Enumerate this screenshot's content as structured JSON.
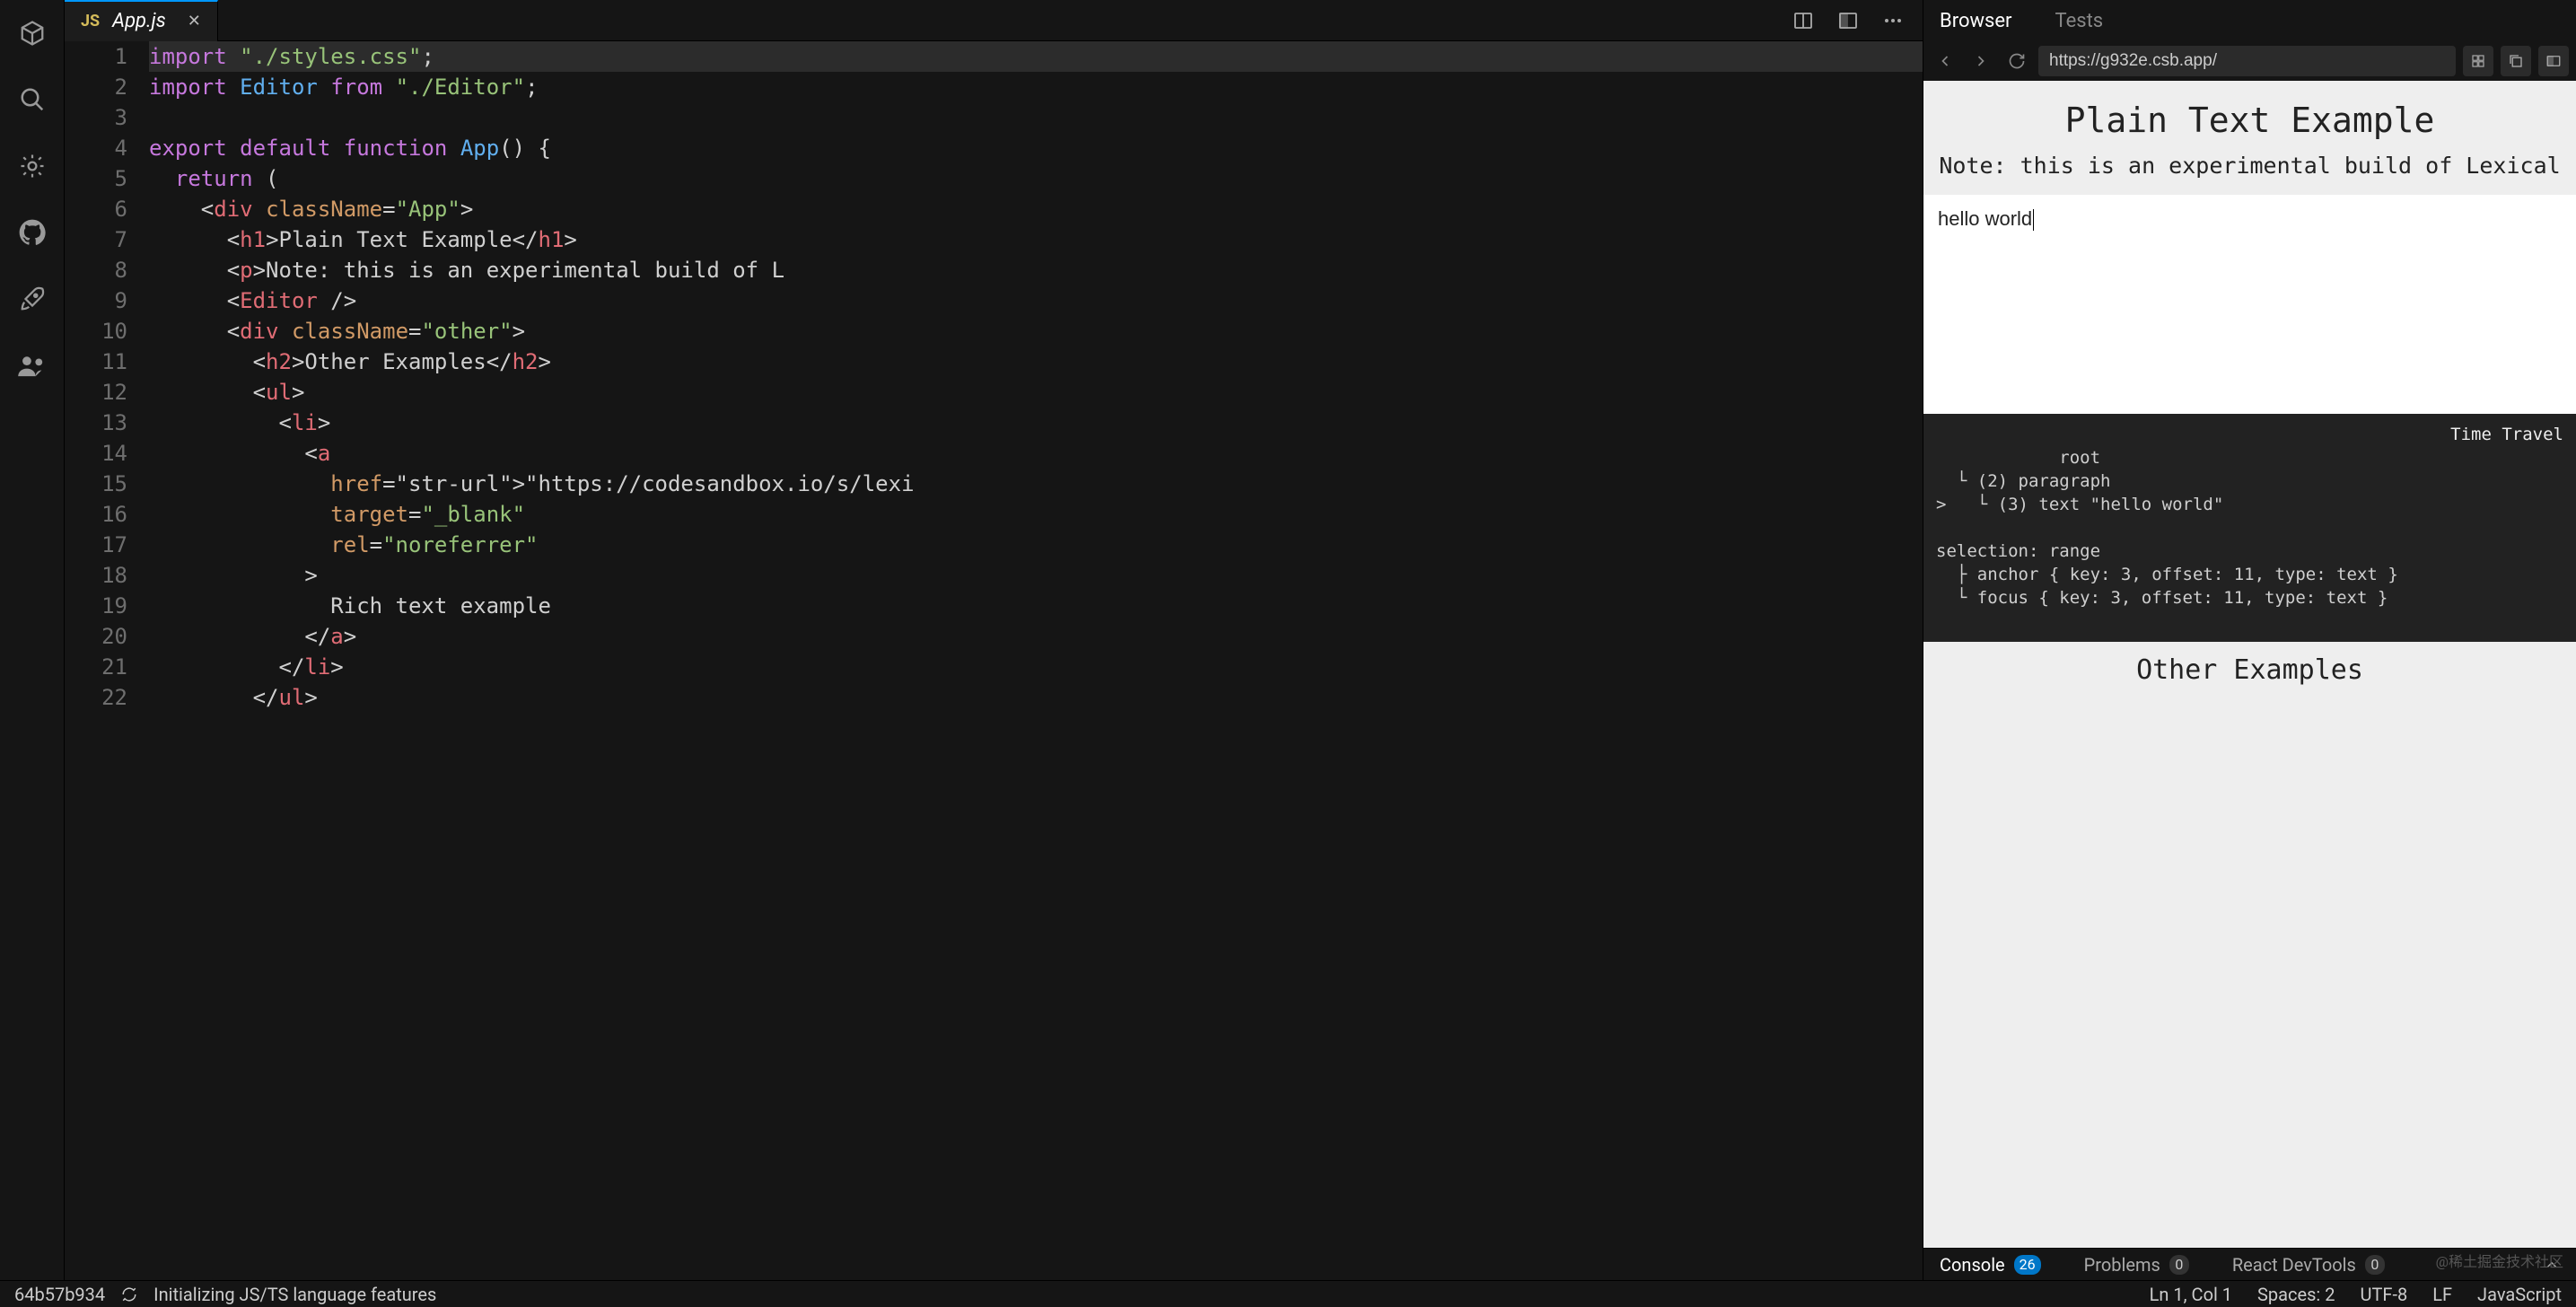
{
  "activity": [
    "cube",
    "search",
    "gear",
    "github",
    "rocket",
    "team"
  ],
  "tab": {
    "language": "JS",
    "filename": "App.js"
  },
  "code_lines": [
    "import \"./styles.css\";",
    "import Editor from \"./Editor\";",
    "",
    "export default function App() {",
    "  return (",
    "    <div className=\"App\">",
    "      <h1>Plain Text Example</h1>",
    "      <p>Note: this is an experimental build of L",
    "      <Editor />",
    "      <div className=\"other\">",
    "        <h2>Other Examples</h2>",
    "        <ul>",
    "          <li>",
    "            <a",
    "              href=\"https://codesandbox.io/s/lexi",
    "              target=\"_blank\"",
    "              rel=\"noreferrer\"",
    "            >",
    "              Rich text example",
    "            </a>",
    "          </li>",
    "        </ul>"
  ],
  "preview_tabs": {
    "browser": "Browser",
    "tests": "Tests"
  },
  "url": "https://g932e.csb.app/",
  "page": {
    "h1": "Plain Text Example",
    "note": "Note: this is an experimental build of Lexical",
    "editor_text": "hello world",
    "time_travel": "Time Travel",
    "tree": "root\n  └ (2) paragraph\n>   └ (3) text \"hello world\"\n\nselection: range\n  ├ anchor { key: 3, offset: 11, type: text }\n  └ focus { key: 3, offset: 11, type: text }",
    "other_h": "Other Examples"
  },
  "devtools": {
    "console": "Console",
    "console_count": "26",
    "problems": "Problems",
    "problems_count": "0",
    "react": "React DevTools",
    "react_count": "0"
  },
  "status": {
    "commit": "64b57b934",
    "init": "Initializing JS/TS language features",
    "lncol": "Ln 1, Col 1",
    "spaces": "Spaces: 2",
    "encoding": "UTF-8",
    "eol": "LF",
    "lang": "JavaScript"
  },
  "watermark": "@稀土掘金技术社区"
}
